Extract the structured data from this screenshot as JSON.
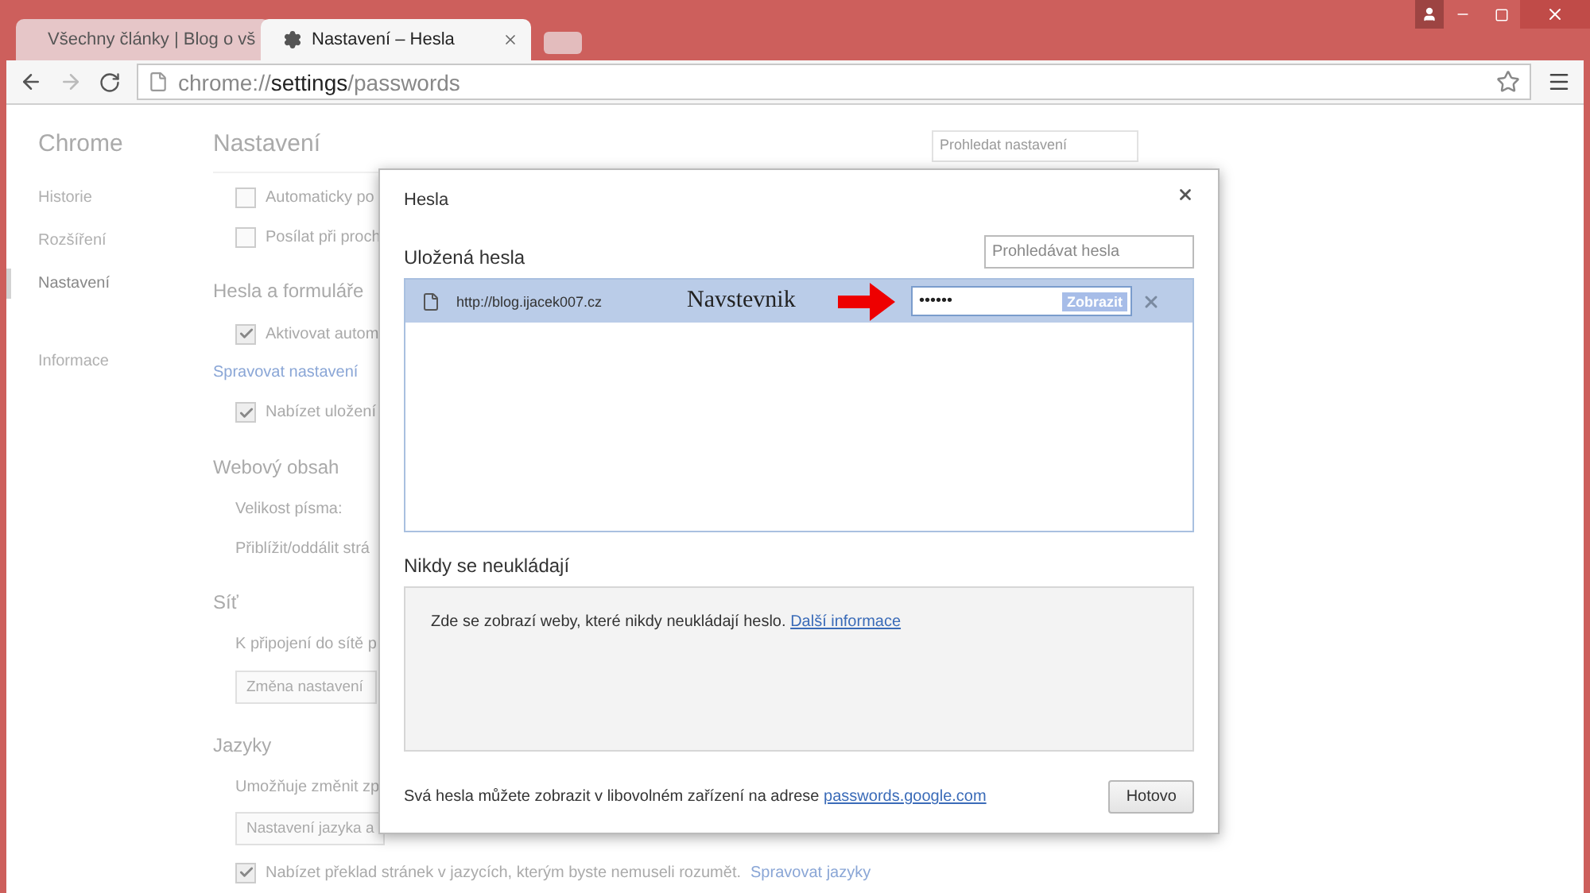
{
  "browser": {
    "tabs": [
      {
        "title": "Všechny články | Blog o vš",
        "kind": "page",
        "selected": false
      },
      {
        "title": "Nastavení – Hesla",
        "kind": "settings",
        "selected": true
      }
    ],
    "address": {
      "scheme": "chrome://",
      "host": "settings",
      "path": "/passwords"
    }
  },
  "sidebar": {
    "title": "Chrome",
    "items": [
      {
        "label": "Historie",
        "selected": false
      },
      {
        "label": "Rozšíření",
        "selected": false
      },
      {
        "label": "Nastavení",
        "selected": true
      },
      {
        "label": "Informace",
        "selected": false
      }
    ]
  },
  "settings": {
    "title": "Nastavení",
    "search": {
      "placeholder": "Prohledat nastavení"
    },
    "rows": [
      {
        "kind": "checkbox",
        "label": "Automaticky po",
        "checked": false
      },
      {
        "kind": "checkbox",
        "label": "Posílat při proch",
        "checked": false
      },
      {
        "kind": "heading",
        "label": "Hesla a formuláře"
      },
      {
        "kind": "checkbox",
        "label": "Aktivovat autom",
        "checked": true
      },
      {
        "kind": "link",
        "label": "Spravovat nastavení"
      },
      {
        "kind": "checkbox",
        "label": "Nabízet uložení",
        "checked": true
      },
      {
        "kind": "heading",
        "label": "Webový obsah"
      },
      {
        "kind": "text",
        "label": "Velikost písma:"
      },
      {
        "kind": "text",
        "label": "Přiblížit/oddálit strá"
      },
      {
        "kind": "heading",
        "label": "Síť"
      },
      {
        "kind": "text",
        "label": "K připojení do sítě p"
      },
      {
        "kind": "button",
        "label": "Změna nastavení"
      },
      {
        "kind": "heading",
        "label": "Jazyky"
      },
      {
        "kind": "text",
        "label": "Umožňuje změnit zp"
      },
      {
        "kind": "button",
        "label": "Nastavení jazyka a"
      },
      {
        "kind": "checkbox",
        "label": "Nabízet překlad stránek v jazycích, kterým byste nemuseli rozumět.",
        "link": "Spravovat jazyky",
        "checked": true
      }
    ]
  },
  "dialog": {
    "title": "Hesla",
    "saved": {
      "heading": "Uložená hesla",
      "search": {
        "placeholder": "Prohledávat hesla"
      },
      "entries": [
        {
          "site": "http://blog.ijacek007.cz",
          "username": "Navstevnik",
          "password": "••••••",
          "show_button": "Zobrazit",
          "selected": true
        }
      ]
    },
    "never": {
      "heading": "Nikdy se neukládají",
      "text": "Zde se zobrazí weby, které nikdy neukládají heslo.",
      "link": "Další informace"
    },
    "footer": {
      "text": "Svá hesla můžete zobrazit v libovolném zařízení na adrese",
      "link": "passwords.google.com"
    },
    "done_button": "Hotovo"
  }
}
